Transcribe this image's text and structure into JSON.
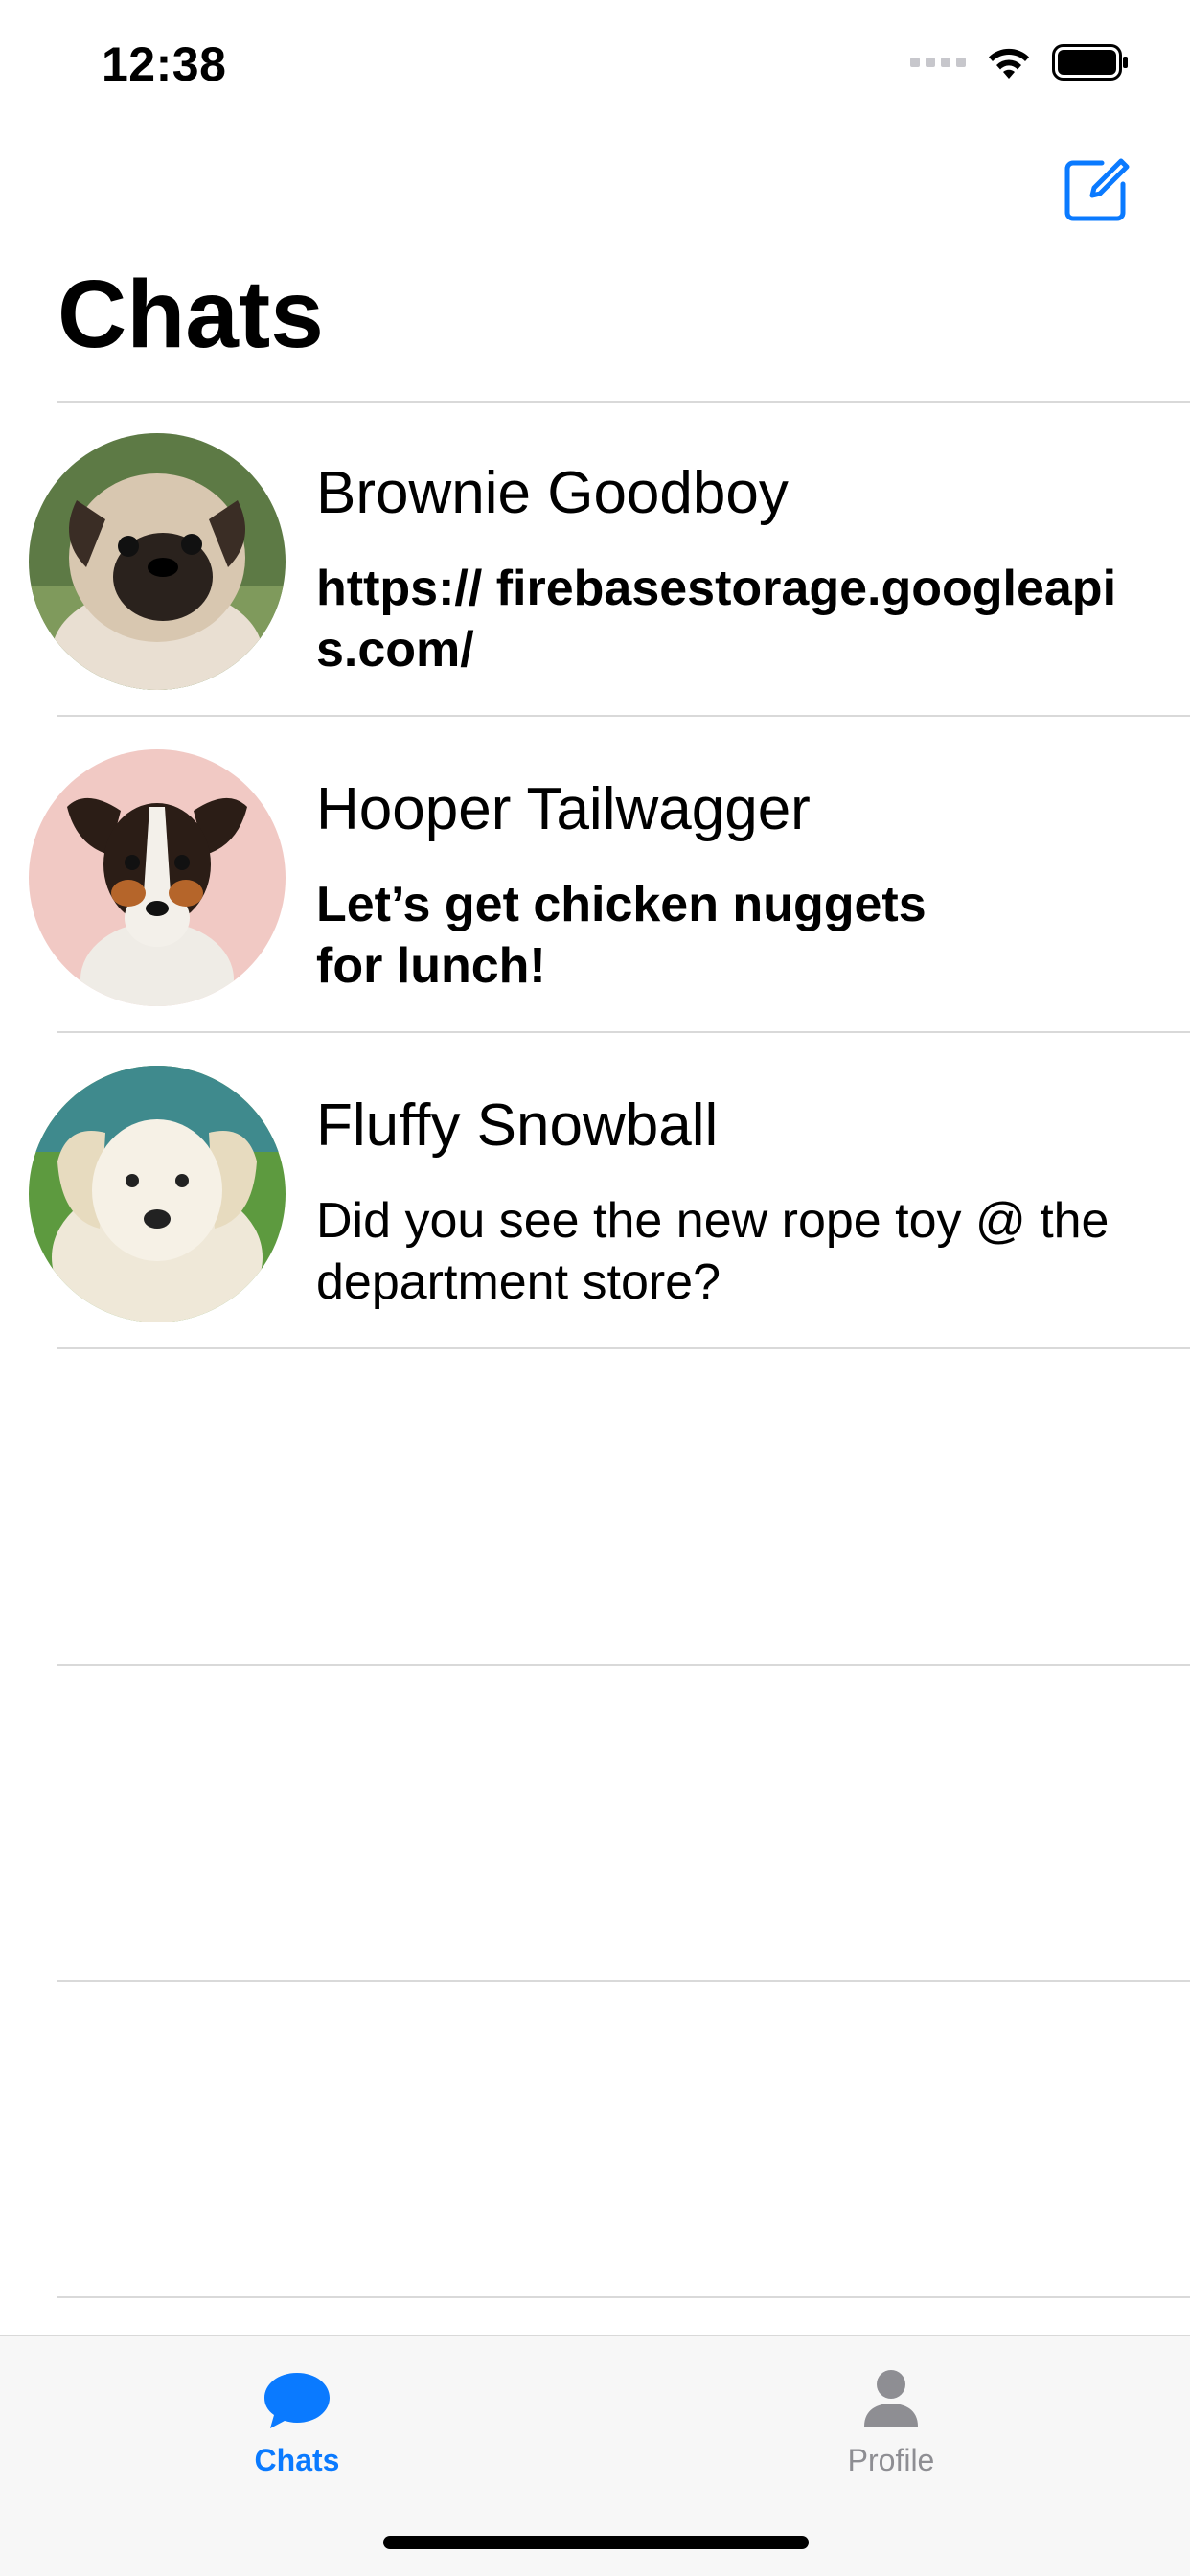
{
  "status_bar": {
    "time": "12:38"
  },
  "header": {
    "title": "Chats",
    "compose_icon": "compose-icon"
  },
  "colors": {
    "accent": "#0A7AFF",
    "inactive": "#8E8E93",
    "divider": "#D9D9D9",
    "tab_bar_bg": "#F7F7F7"
  },
  "chats": [
    {
      "name": "Brownie Goodboy",
      "preview": "https:// firebasestorage.googleapis.com/",
      "unread": true
    },
    {
      "name": "Hooper Tailwagger",
      "preview": "Let’s get chicken nuggets for lunch!",
      "unread": true
    },
    {
      "name": "Fluffy Snowball",
      "preview": "Did you see the new rope toy @ the department store?",
      "unread": false
    }
  ],
  "tab_bar": {
    "tabs": [
      {
        "label": "Chats",
        "icon": "chat-bubble-icon",
        "selected": true
      },
      {
        "label": "Profile",
        "icon": "person-icon",
        "selected": false
      }
    ]
  }
}
